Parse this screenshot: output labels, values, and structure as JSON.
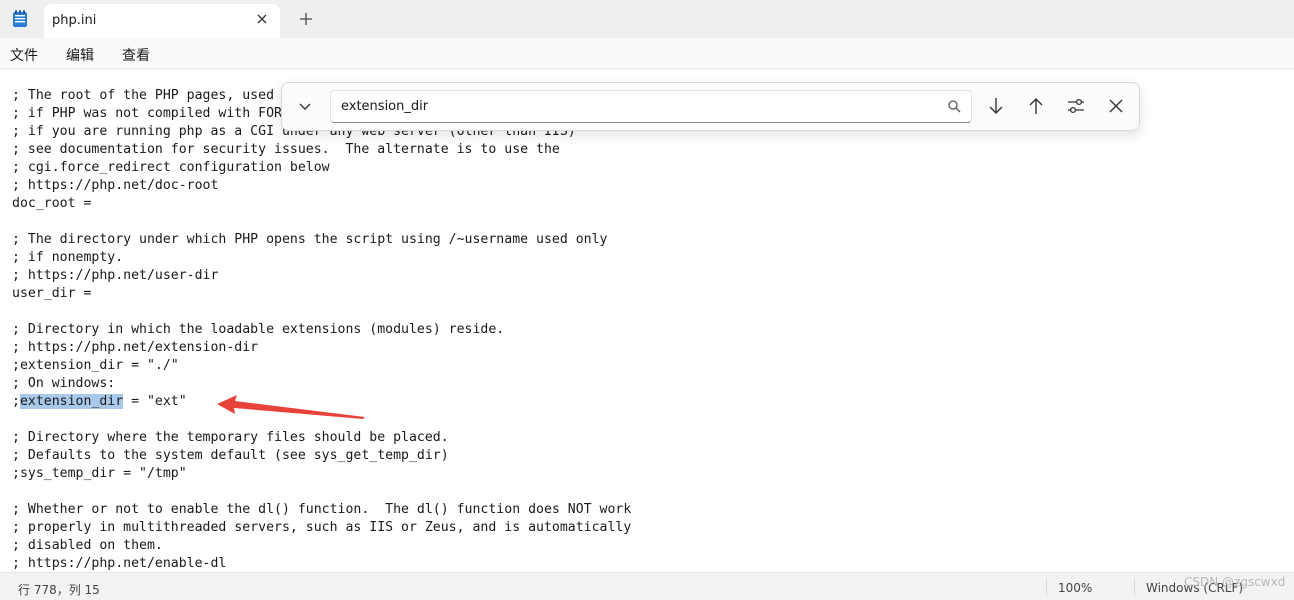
{
  "tab": {
    "title": "php.ini"
  },
  "menu": {
    "file": "文件",
    "edit": "编辑",
    "view": "查看"
  },
  "find": {
    "query": "extension_dir"
  },
  "editor": {
    "lines": [
      "; The root of the PHP pages, used",
      "; if PHP was not compiled with FOR",
      "; if you are running php as a CGI under any web server (other than IIS)",
      "; see documentation for security issues.  The alternate is to use the",
      "; cgi.force_redirect configuration below",
      "; https://php.net/doc-root",
      "doc_root =",
      "",
      "; The directory under which PHP opens the script using /~username used only",
      "; if nonempty.",
      "; https://php.net/user-dir",
      "user_dir =",
      "",
      "; Directory in which the loadable extensions (modules) reside.",
      "; https://php.net/extension-dir",
      ";extension_dir = \"./\"",
      "; On windows:",
      "",
      "",
      "; Directory where the temporary files should be placed.",
      "; Defaults to the system default (see sys_get_temp_dir)",
      ";sys_temp_dir = \"/tmp\"",
      "",
      "; Whether or not to enable the dl() function.  The dl() function does NOT work",
      "; properly in multithreaded servers, such as IIS or Zeus, and is automatically",
      "; disabled on them.",
      "; https://php.net/enable-dl"
    ],
    "match_line": {
      "prefix": ";",
      "match": "extension_dir",
      "suffix": " = \"ext\""
    }
  },
  "status": {
    "position": "行 778，列 15",
    "zoom": "100%",
    "line_ending": "Windows (CRLF)"
  },
  "watermark": "CSDN @zgscwxd",
  "colors": {
    "selection": "#a9c9ea",
    "annotation_arrow": "#e8433a"
  }
}
